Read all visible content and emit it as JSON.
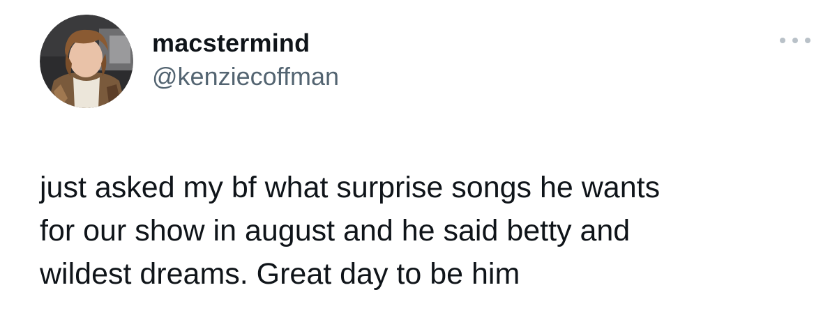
{
  "tweet": {
    "author": {
      "display_name": "macstermind",
      "handle": "@kenziecoffman"
    },
    "text": "just asked my bf what surprise songs he wants\nfor our show in august and he said betty and\nwildest dreams. Great day to be him",
    "more_icon": "more-horizontal-icon"
  }
}
